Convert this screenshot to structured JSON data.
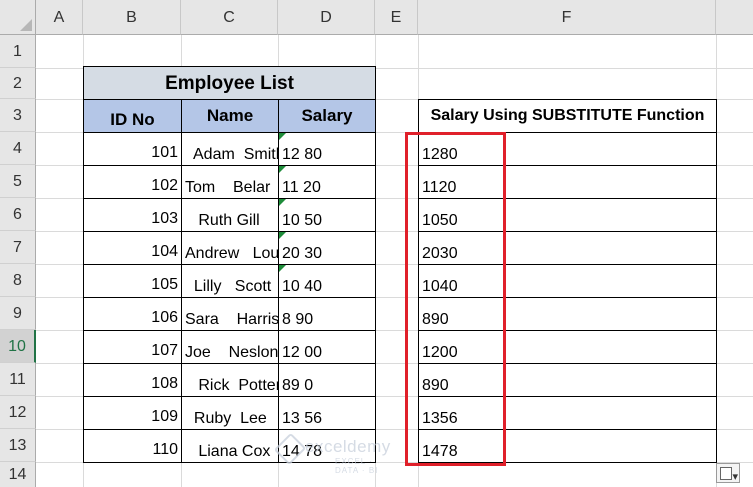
{
  "columns": [
    "A",
    "B",
    "C",
    "D",
    "E",
    "F"
  ],
  "rows": [
    "1",
    "2",
    "3",
    "4",
    "5",
    "6",
    "7",
    "8",
    "9",
    "10",
    "11",
    "12",
    "13",
    "14"
  ],
  "active_row": "10",
  "table": {
    "title": "Employee List",
    "headers": {
      "id": "ID No",
      "name": "Name",
      "salary": "Salary"
    },
    "records": [
      {
        "id": "101",
        "name": "  Adam  Smith",
        "salary": "12 80"
      },
      {
        "id": "102",
        "name": "Tom    Belar",
        "salary": "11 20"
      },
      {
        "id": "103",
        "name": "   Ruth Gill",
        "salary": "10 50"
      },
      {
        "id": "104",
        "name": "Andrew   Louis",
        "salary": "20 30"
      },
      {
        "id": "105",
        "name": "  Lilly   Scott",
        "salary": "10 40"
      },
      {
        "id": "106",
        "name": "Sara    Harris",
        "salary": "8 90"
      },
      {
        "id": "107",
        "name": "Joe    Neslon",
        "salary": "12 00"
      },
      {
        "id": "108",
        "name": "   Rick  Potter",
        "salary": "89 0"
      },
      {
        "id": "109",
        "name": "  Ruby  Lee",
        "salary": "13 56"
      },
      {
        "id": "110",
        "name": "   Liana Cox",
        "salary": "14 78"
      }
    ]
  },
  "result": {
    "header": "Salary Using SUBSTITUTE Function",
    "values": [
      "1280",
      "1120",
      "1050",
      "2030",
      "1040",
      "890",
      "1200",
      "890",
      "1356",
      "1478"
    ]
  },
  "watermark": {
    "brand": "exceldemy",
    "tagline": "EXCEL · DATA · BI"
  },
  "colors": {
    "title_fill": "#d5dce4",
    "header_fill": "#b4c6e7",
    "highlight_border": "#e0202a",
    "error_indicator": "#1e8c3a"
  },
  "icons": [
    "paste-options-icon"
  ]
}
